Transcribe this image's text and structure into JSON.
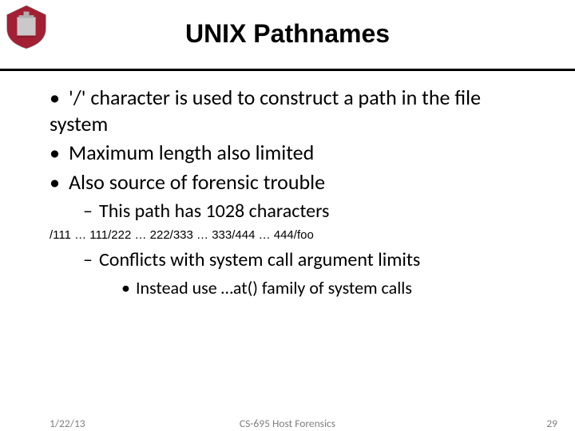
{
  "title": "UNIX Pathnames",
  "bullets": {
    "b1": "'/' character is used to construct a path in the file system",
    "b2": "Maximum length also limited",
    "b3": "Also source of forensic trouble",
    "s1": "This path has 1028 characters",
    "code": "/111 … 111/222 … 222/333 … 333/444 … 444/foo",
    "s2": "Conflicts with system call argument limits",
    "ss1": "Instead use …at() family of system calls"
  },
  "footer": {
    "date": "1/22/13",
    "course": "CS-695 Host Forensics",
    "page": "29"
  },
  "marks": {
    "dot": "•",
    "dash": "–"
  }
}
